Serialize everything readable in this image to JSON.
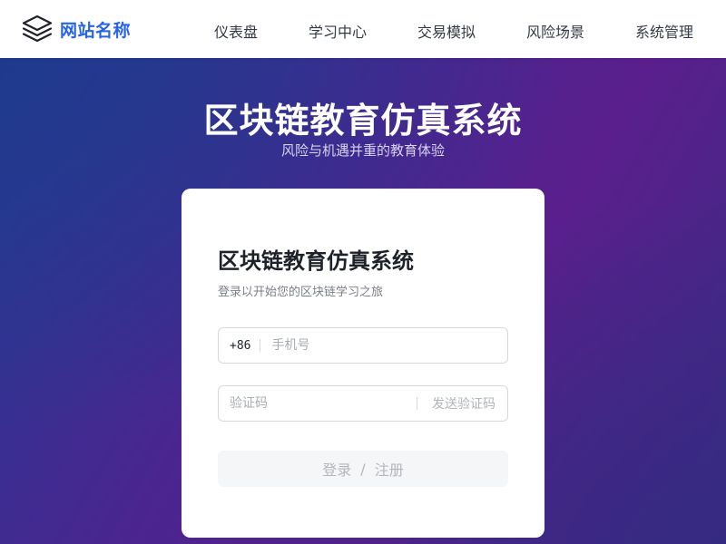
{
  "brand": {
    "name": "网站名称",
    "icon": "layers-icon",
    "color": "#2563eb"
  },
  "nav": {
    "items": [
      {
        "label": "仪表盘"
      },
      {
        "label": "学习中心"
      },
      {
        "label": "交易模拟"
      },
      {
        "label": "风险场景"
      },
      {
        "label": "系统管理"
      }
    ]
  },
  "hero": {
    "title": "区块链教育仿真系统",
    "subtitle": "风险与机遇并重的教育体验"
  },
  "login": {
    "title": "区块链教育仿真系统",
    "subtitle": "登录以开始您的区块链学习之旅",
    "country_code": "+86",
    "phone_placeholder": "手机号",
    "phone_value": "",
    "code_placeholder": "验证码",
    "code_value": "",
    "send_code_label": "发送验证码",
    "login_label": "登录",
    "separator": "/",
    "register_label": "注册"
  }
}
